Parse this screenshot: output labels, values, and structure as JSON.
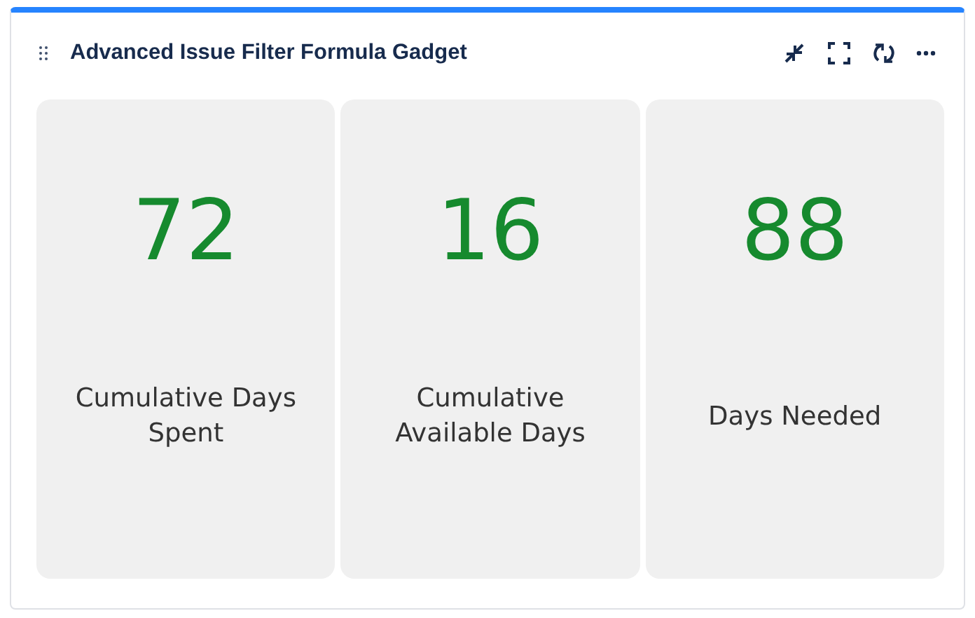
{
  "gadget": {
    "title": "Advanced Issue Filter Formula Gadget"
  },
  "tiles": [
    {
      "value": "72",
      "label": "Cumulative Days Spent"
    },
    {
      "value": "16",
      "label": "Cumulative Available Days"
    },
    {
      "value": "88",
      "label": "Days Needed"
    }
  ]
}
